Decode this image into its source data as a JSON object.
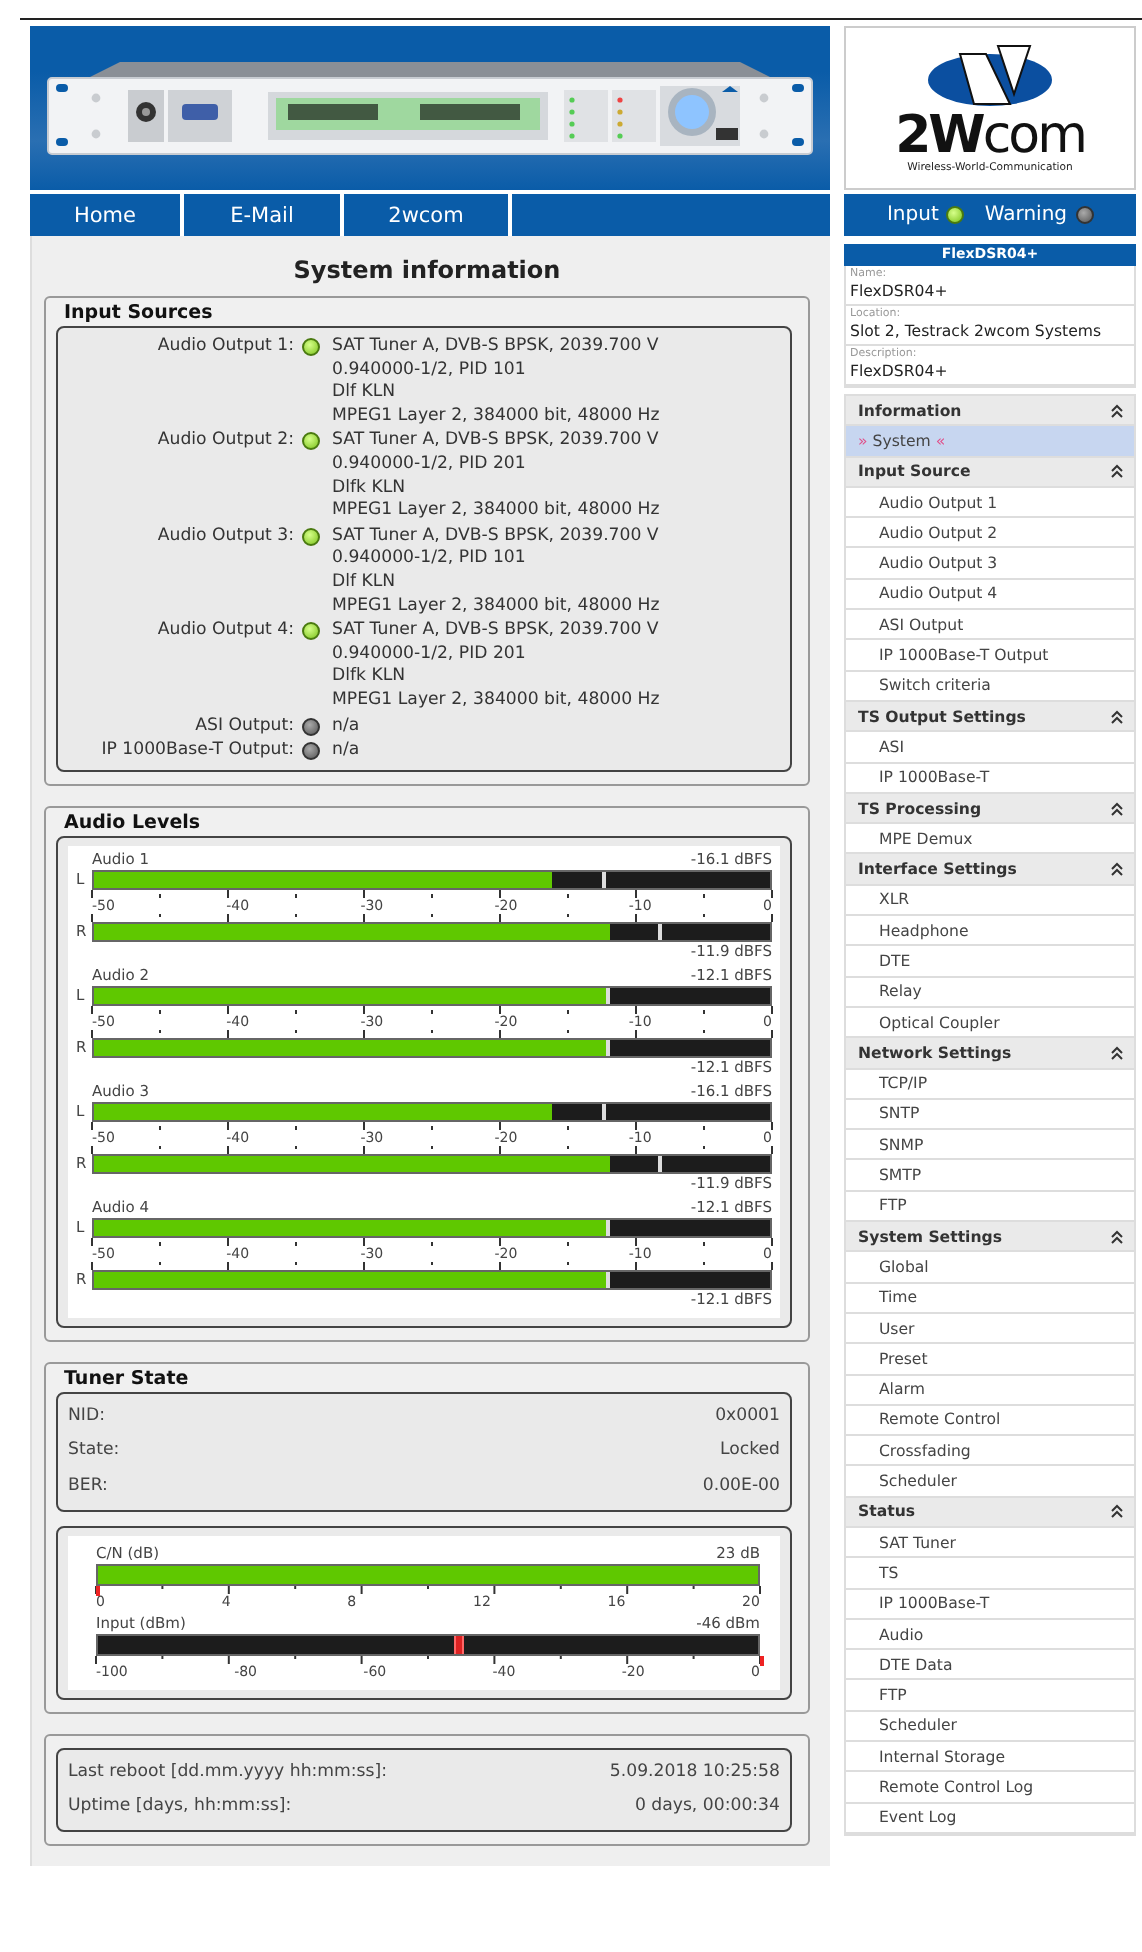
{
  "header": {
    "logo": {
      "brand": "**2W**com",
      "tagline": "Wireless-World-Communication"
    }
  },
  "nav": [
    {
      "label": "Home"
    },
    {
      "label": "E-Mail"
    },
    {
      "label": "2wcom"
    }
  ],
  "status": [
    {
      "label": "Input",
      "on": true
    },
    {
      "label": "Warning",
      "on": false
    }
  ],
  "page_title": "System information",
  "input_sources": {
    "title": "Input Sources",
    "rows": [
      {
        "label": "Audio Output 1:",
        "active": true,
        "lines": [
          "SAT Tuner A, DVB-S BPSK, 2039.700 V",
          "0.940000-1/2, PID 101",
          "Dlf KLN",
          "MPEG1 Layer 2, 384000 bit, 48000 Hz"
        ]
      },
      {
        "label": "Audio Output 2:",
        "active": true,
        "lines": [
          "SAT Tuner A, DVB-S BPSK, 2039.700 V",
          "0.940000-1/2, PID 201",
          "Dlfk KLN",
          "MPEG1 Layer 2, 384000 bit, 48000 Hz"
        ]
      },
      {
        "label": "Audio Output 3:",
        "active": true,
        "lines": [
          "SAT Tuner A, DVB-S BPSK, 2039.700 V",
          "0.940000-1/2, PID 101",
          "Dlf KLN",
          "MPEG1 Layer 2, 384000 bit, 48000 Hz"
        ]
      },
      {
        "label": "Audio Output 4:",
        "active": true,
        "lines": [
          "SAT Tuner A, DVB-S BPSK, 2039.700 V",
          "0.940000-1/2, PID 201",
          "Dlfk KLN",
          "MPEG1 Layer 2, 384000 bit, 48000 Hz"
        ]
      },
      {
        "label": "ASI Output:",
        "active": false,
        "lines": [
          "n/a"
        ]
      },
      {
        "label": "IP 1000Base-T Output:",
        "active": false,
        "lines": [
          "n/a"
        ]
      }
    ]
  },
  "audio_levels": {
    "title": "Audio Levels",
    "groups": [
      {
        "name": "Audio 1",
        "left": {
          "label": "L",
          "level": 0.678,
          "peak_marker": {
            "level": 0.752
          },
          "reading": "-16.1 dBFS"
        },
        "scale": [
          "-50",
          "-40",
          "-30",
          "-20",
          "-10",
          "0"
        ],
        "right": {
          "label": "R",
          "level": 0.762,
          "peak_marker": {
            "level": 0.835
          },
          "reading": "-11.9 dBFS"
        }
      },
      {
        "name": "Audio 2",
        "left": {
          "label": "L",
          "level": 0.758,
          "peak_marker": {
            "level": 0.758
          },
          "reading": "-12.1 dBFS"
        },
        "scale": [
          "-50",
          "-40",
          "-30",
          "-20",
          "-10",
          "0"
        ],
        "right": {
          "label": "R",
          "level": 0.758,
          "peak_marker": {
            "level": 0.758
          },
          "reading": "-12.1 dBFS"
        }
      },
      {
        "name": "Audio 3",
        "left": {
          "label": "L",
          "level": 0.678,
          "peak_marker": {
            "level": 0.752
          },
          "reading": "-16.1 dBFS"
        },
        "scale": [
          "-50",
          "-40",
          "-30",
          "-20",
          "-10",
          "0"
        ],
        "right": {
          "label": "R",
          "level": 0.762,
          "peak_marker": {
            "level": 0.835
          },
          "reading": "-11.9 dBFS"
        }
      },
      {
        "name": "Audio 4",
        "left": {
          "label": "L",
          "level": 0.758,
          "peak_marker": {
            "level": 0.758
          },
          "reading": "-12.1 dBFS"
        },
        "scale": [
          "-50",
          "-40",
          "-30",
          "-20",
          "-10",
          "0"
        ],
        "right": {
          "label": "R",
          "level": 0.758,
          "peak_marker": {
            "level": 0.758
          },
          "reading": "-12.1 dBFS"
        }
      }
    ]
  },
  "tuner_state": {
    "title": "Tuner State",
    "rows": [
      {
        "label": "NID:",
        "value": "0x0001"
      },
      {
        "label": "State:",
        "value": "Locked"
      },
      {
        "label": "BER:",
        "value": "0.00E-00"
      }
    ],
    "meters": [
      {
        "kind": "fill",
        "label": "C/N (dB)",
        "reading": "23 dB",
        "level": 1.0,
        "threshold": {
          "level": 0
        },
        "scale": [
          "0",
          "4",
          "8",
          "12",
          "16",
          "20"
        ]
      },
      {
        "kind": "indicator",
        "label": "Input (dBm)",
        "reading": "-46 dBm",
        "level": 0.54,
        "threshold": {
          "level": 1.0
        },
        "scale": [
          "-100",
          "-80",
          "-60",
          "-40",
          "-20",
          "0"
        ]
      }
    ]
  },
  "uptime": {
    "rows": [
      {
        "label": "Last reboot [dd.mm.yyyy hh:mm:ss]:",
        "value": "5.09.2018 10:25:58"
      },
      {
        "label": "Uptime [days, hh:mm:ss]:",
        "value": "0 days, 00:00:34"
      }
    ]
  },
  "sidebar": {
    "device": {
      "title": "FlexDSR04+",
      "fields": [
        {
          "label": "Name:",
          "value": "FlexDSR04+"
        },
        {
          "label": "Location:",
          "value": "Slot 2, Testrack 2wcom Systems"
        },
        {
          "label": "Description:",
          "value": "FlexDSR04+"
        }
      ]
    },
    "menu": [
      {
        "title": "Information",
        "expanded": true,
        "items": [
          {
            "label": "System",
            "selected": true,
            "before": "»",
            "after": "«"
          }
        ]
      },
      {
        "title": "Input Source",
        "expanded": true,
        "items": [
          {
            "label": "Audio Output 1",
            "selected": false
          },
          {
            "label": "Audio Output 2",
            "selected": false
          },
          {
            "label": "Audio Output 3",
            "selected": false
          },
          {
            "label": "Audio Output 4",
            "selected": false
          },
          {
            "label": "ASI Output",
            "selected": false
          },
          {
            "label": "IP 1000Base-T Output",
            "selected": false
          },
          {
            "label": "Switch criteria",
            "selected": false
          }
        ]
      },
      {
        "title": "TS Output Settings",
        "expanded": true,
        "items": [
          {
            "label": "ASI",
            "selected": false
          },
          {
            "label": "IP 1000Base-T",
            "selected": false
          }
        ]
      },
      {
        "title": "TS Processing",
        "expanded": true,
        "items": [
          {
            "label": "MPE Demux",
            "selected": false
          }
        ]
      },
      {
        "title": "Interface Settings",
        "expanded": true,
        "items": [
          {
            "label": "XLR",
            "selected": false
          },
          {
            "label": "Headphone",
            "selected": false
          },
          {
            "label": "DTE",
            "selected": false
          },
          {
            "label": "Relay",
            "selected": false
          },
          {
            "label": "Optical Coupler",
            "selected": false
          }
        ]
      },
      {
        "title": "Network Settings",
        "expanded": true,
        "items": [
          {
            "label": "TCP/IP",
            "selected": false
          },
          {
            "label": "SNTP",
            "selected": false
          },
          {
            "label": "SNMP",
            "selected": false
          },
          {
            "label": "SMTP",
            "selected": false
          },
          {
            "label": "FTP",
            "selected": false
          }
        ]
      },
      {
        "title": "System Settings",
        "expanded": true,
        "items": [
          {
            "label": "Global",
            "selected": false
          },
          {
            "label": "Time",
            "selected": false
          },
          {
            "label": "User",
            "selected": false
          },
          {
            "label": "Preset",
            "selected": false
          },
          {
            "label": "Alarm",
            "selected": false
          },
          {
            "label": "Remote Control",
            "selected": false
          },
          {
            "label": "Crossfading",
            "selected": false
          },
          {
            "label": "Scheduler",
            "selected": false
          }
        ]
      },
      {
        "title": "Status",
        "expanded": true,
        "items": [
          {
            "label": "SAT Tuner",
            "selected": false
          },
          {
            "label": "TS",
            "selected": false
          },
          {
            "label": "IP 1000Base-T",
            "selected": false
          },
          {
            "label": "Audio",
            "selected": false
          },
          {
            "label": "DTE Data",
            "selected": false
          },
          {
            "label": "FTP",
            "selected": false
          },
          {
            "label": "Scheduler",
            "selected": false
          },
          {
            "label": "Internal Storage",
            "selected": false
          },
          {
            "label": "Remote Control Log",
            "selected": false
          },
          {
            "label": "Event Log",
            "selected": false
          }
        ]
      }
    ]
  }
}
